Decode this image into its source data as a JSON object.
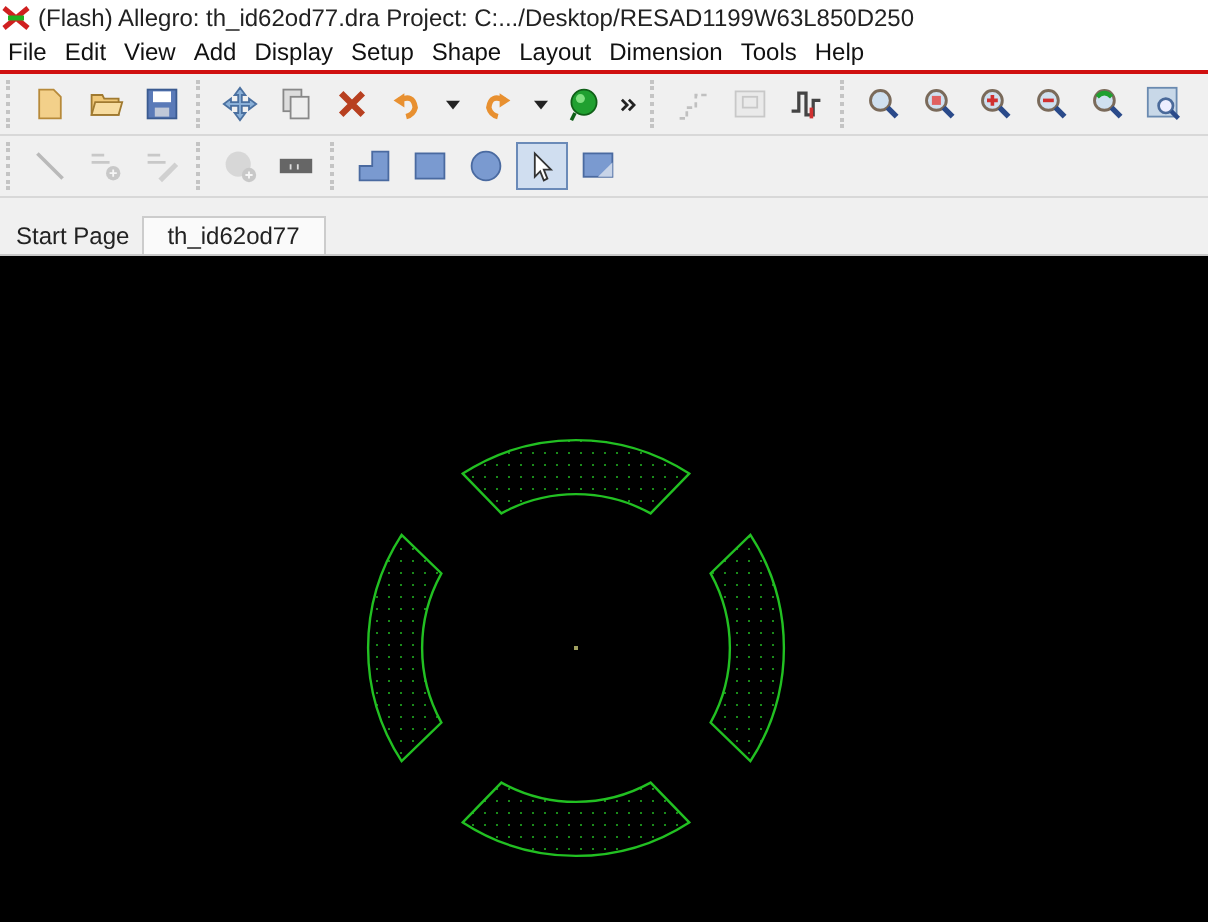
{
  "window": {
    "title": "(Flash) Allegro: th_id62od77.dra  Project: C:.../Desktop/RESAD1199W63L850D250"
  },
  "menu": [
    "File",
    "Edit",
    "View",
    "Add",
    "Display",
    "Setup",
    "Shape",
    "Layout",
    "Dimension",
    "Tools",
    "Help"
  ],
  "toolbars": [
    {
      "groups": [
        {
          "buttons": [
            {
              "kind": "new",
              "disabled": false
            },
            {
              "kind": "open",
              "disabled": false
            },
            {
              "kind": "save",
              "disabled": false
            }
          ]
        },
        {
          "buttons": [
            {
              "kind": "move",
              "disabled": false
            },
            {
              "kind": "copy",
              "disabled": false
            },
            {
              "kind": "delete",
              "disabled": false
            },
            {
              "kind": "undo",
              "disabled": false
            },
            {
              "kind": "dropdown",
              "disabled": false
            },
            {
              "kind": "redo",
              "disabled": false
            },
            {
              "kind": "dropdown",
              "disabled": false
            },
            {
              "kind": "ball",
              "disabled": false
            },
            {
              "kind": "more",
              "disabled": false
            }
          ]
        },
        {
          "buttons": [
            {
              "kind": "route",
              "disabled": true
            },
            {
              "kind": "board",
              "disabled": true
            },
            {
              "kind": "signal",
              "disabled": false
            }
          ]
        },
        {
          "buttons": [
            {
              "kind": "zoomfit",
              "disabled": false
            },
            {
              "kind": "zoombox",
              "disabled": false
            },
            {
              "kind": "zoomin",
              "disabled": false
            },
            {
              "kind": "zoomout",
              "disabled": false
            },
            {
              "kind": "zoomprev",
              "disabled": false
            },
            {
              "kind": "zoomworld",
              "disabled": false
            }
          ]
        }
      ]
    },
    {
      "groups": [
        {
          "buttons": [
            {
              "kind": "line",
              "disabled": true,
              "selected": false
            },
            {
              "kind": "textadd",
              "disabled": true,
              "selected": false
            },
            {
              "kind": "textedit",
              "disabled": true,
              "selected": false
            }
          ]
        },
        {
          "buttons": [
            {
              "kind": "padadd",
              "disabled": true,
              "selected": false
            },
            {
              "kind": "refdes",
              "disabled": false,
              "selected": false
            }
          ]
        },
        {
          "buttons": [
            {
              "kind": "poly",
              "disabled": false,
              "selected": false
            },
            {
              "kind": "rect",
              "disabled": false,
              "selected": false
            },
            {
              "kind": "circle",
              "disabled": false,
              "selected": false
            },
            {
              "kind": "select",
              "disabled": false,
              "selected": true
            },
            {
              "kind": "shapeedit",
              "disabled": false,
              "selected": false
            }
          ]
        }
      ]
    }
  ],
  "tabs": [
    {
      "label": "Start Page",
      "selected": false
    },
    {
      "label": "th_id62od77",
      "selected": true
    }
  ],
  "canvas": {
    "pads": [
      {
        "kind": "top"
      },
      {
        "kind": "right"
      },
      {
        "kind": "left"
      },
      {
        "kind": "bottom"
      }
    ]
  }
}
